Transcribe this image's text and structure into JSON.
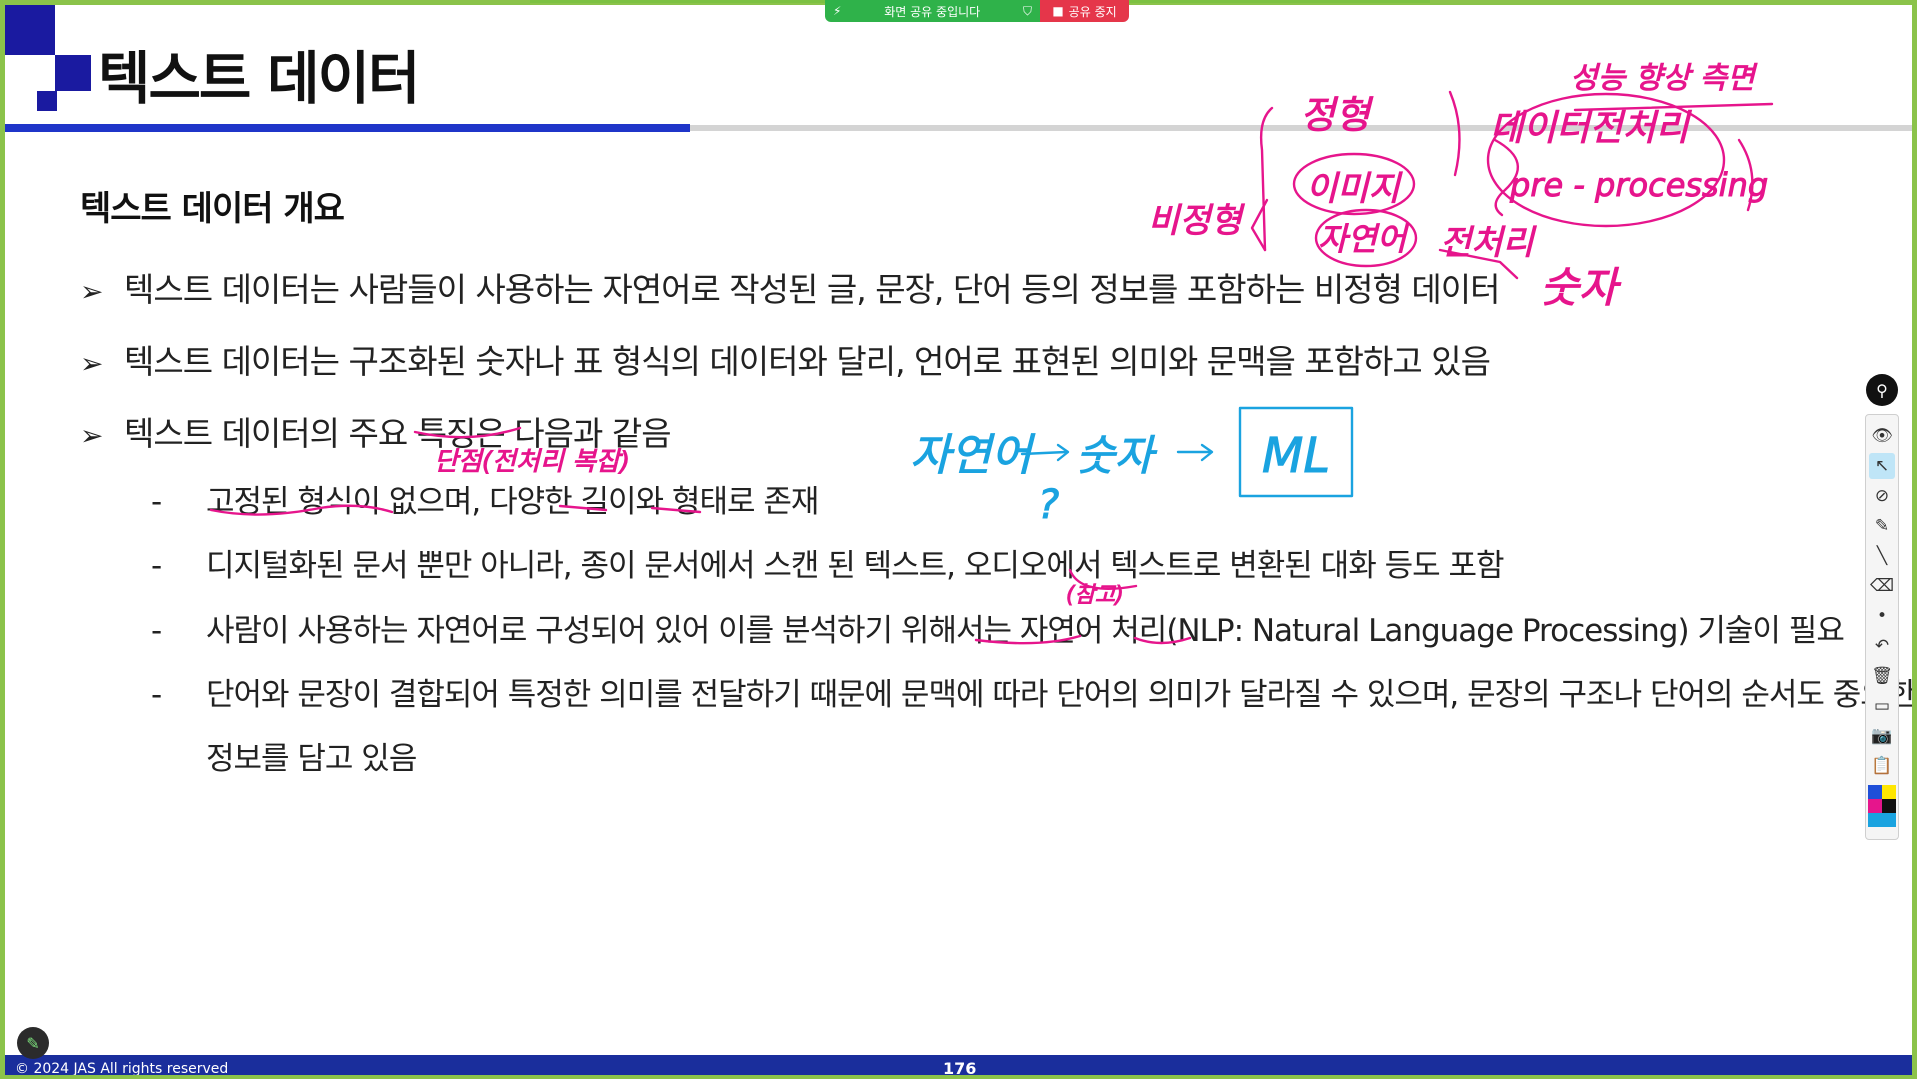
{
  "share": {
    "status_label": "화면 공유 중입니다",
    "stop_label": "공유 중지"
  },
  "slide": {
    "title": "텍스트 데이터",
    "section_heading": "텍스트 데이터 개요",
    "bullets": [
      "텍스트 데이터는 사람들이 사용하는 자연어로 작성된 글, 문장, 단어 등의 정보를 포함하는 비정형 데이터",
      "텍스트 데이터는 구조화된 숫자나 표 형식의 데이터와 달리, 언어로 표현된 의미와 문맥을 포함하고 있음",
      "텍스트 데이터의 주요 특징은 다음과 같음"
    ],
    "sub_bullets": [
      "고정된 형식이 없으며, 다양한 길이와 형태로 존재",
      "디지털화된 문서 뿐만 아니라, 종이 문서에서 스캔 된 텍스트, 오디오에서 텍스트로 변환된 대화 등도 포함",
      "사람이 사용하는 자연어로 구성되어 있어 이를 분석하기 위해서는 자연어 처리(NLP: Natural Language Processing) 기술이 필요",
      "단어와 문장이 결합되어 특정한 의미를 전달하기 때문에 문맥에 따라 단어의 의미가 달라질 수 있으며, 문장의 구조나 단어의 순서도 중요한"
    ],
    "sub_bullet_continuation": "정보를 담고 있음",
    "copyright": "© 2024 JAS All rights reserved",
    "page_number": "176"
  },
  "annotations": {
    "pink": [
      "정형",
      "이미지",
      "자연어",
      "전처리",
      "비정형",
      "데이터전처리",
      "성능 향상 측면",
      "pre - processing",
      "숫자",
      "단점(전처리 복잡)",
      "(참고)"
    ],
    "blue": [
      "자연어",
      "숫자",
      "ML",
      "?"
    ],
    "pink_color": "#e6158c",
    "blue_color": "#1aa3e0"
  },
  "toolbar": {
    "tools": [
      "pin-icon",
      "eye-icon",
      "pointer-icon",
      "no-pen-icon",
      "highlighter-icon",
      "line-icon",
      "eraser-icon",
      "dot-icon",
      "undo-icon",
      "trash-icon",
      "whiteboard-icon",
      "camera-icon",
      "clipboard-icon"
    ],
    "colors": [
      "#1f4fd8",
      "#ffe600",
      "#e6158c",
      "#111111",
      "#1aa3e0",
      "#1aa3e0"
    ]
  }
}
